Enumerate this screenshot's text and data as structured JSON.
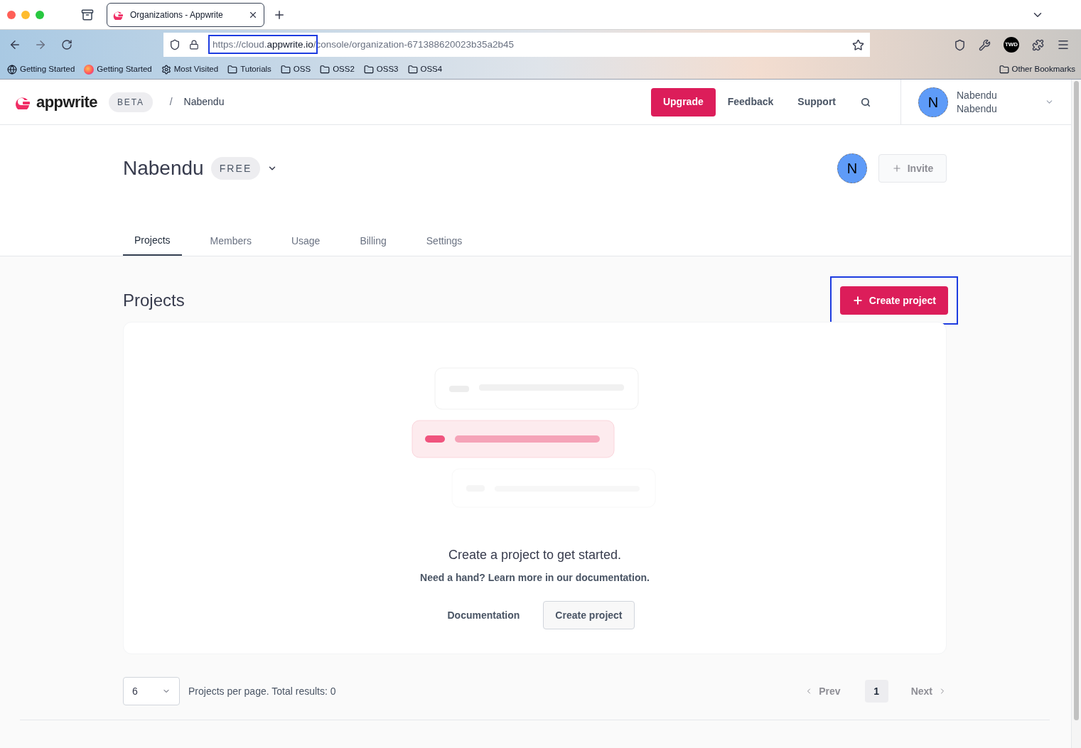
{
  "browser": {
    "tab_title": "Organizations - Appwrite",
    "url": {
      "scheme_part": "https://cloud.",
      "domain": "appwrite.io",
      "path": "/console/organization-671388620023b35a2b45"
    },
    "bookmarks": [
      {
        "kind": "globe",
        "label": "Getting Started"
      },
      {
        "kind": "firefox",
        "label": "Getting Started"
      },
      {
        "kind": "gear",
        "label": "Most Visited"
      },
      {
        "kind": "folder",
        "label": "Tutorials"
      },
      {
        "kind": "folder",
        "label": "OSS"
      },
      {
        "kind": "folder",
        "label": "OSS2"
      },
      {
        "kind": "folder",
        "label": "OSS3"
      },
      {
        "kind": "folder",
        "label": "OSS4"
      }
    ],
    "other_bookmarks": "Other Bookmarks",
    "profile_badge": "TWD"
  },
  "header": {
    "logo": "appwrite",
    "badge": "BETA",
    "separator": "/",
    "breadcrumb": "Nabendu",
    "upgrade": "Upgrade",
    "links": [
      "Feedback",
      "Support"
    ],
    "user": {
      "initial": "N",
      "name": "Nabendu",
      "subtitle": "Nabendu"
    }
  },
  "organization": {
    "name": "Nabendu",
    "plan": "FREE",
    "member_initial": "N",
    "invite": {
      "label": "Invite",
      "disabled": true
    }
  },
  "tabs": [
    {
      "label": "Projects",
      "selected": true
    },
    {
      "label": "Members",
      "selected": false
    },
    {
      "label": "Usage",
      "selected": false
    },
    {
      "label": "Billing",
      "selected": false
    },
    {
      "label": "Settings",
      "selected": false
    }
  ],
  "projects": {
    "heading": "Projects",
    "create_button": "Create project",
    "empty_state": {
      "title": "Create a project to get started.",
      "subtitle": "Need a hand? Learn more in our documentation.",
      "documentation": "Documentation",
      "create": "Create project"
    },
    "pagination": {
      "per_page": "6",
      "summary": "Projects per page. Total results: 0",
      "prev": {
        "label": "Prev",
        "disabled": true
      },
      "page": "1",
      "next": {
        "label": "Next",
        "disabled": true
      }
    }
  }
}
